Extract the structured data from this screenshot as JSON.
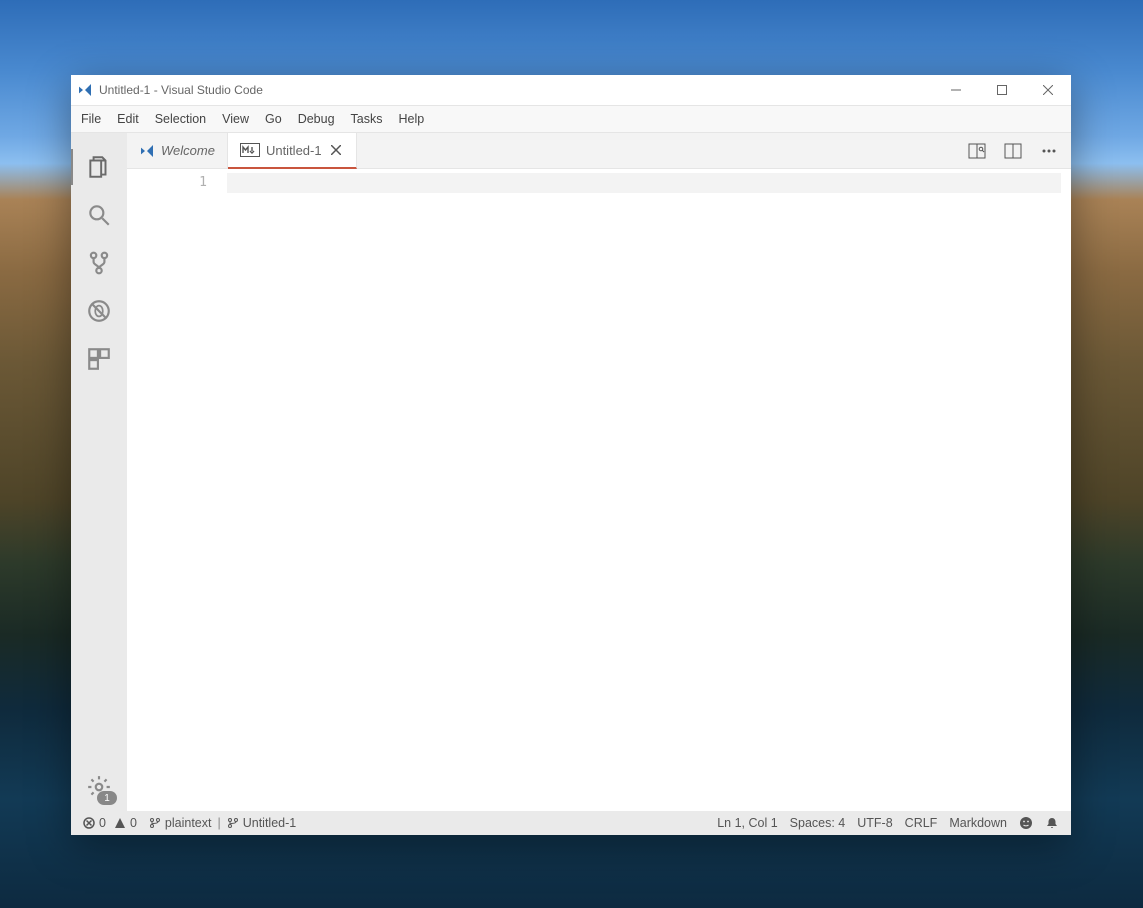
{
  "window": {
    "title": "Untitled-1 - Visual Studio Code"
  },
  "menubar": [
    "File",
    "Edit",
    "Selection",
    "View",
    "Go",
    "Debug",
    "Tasks",
    "Help"
  ],
  "activitybar": {
    "items": [
      {
        "name": "explorer-icon"
      },
      {
        "name": "search-icon"
      },
      {
        "name": "source-control-icon"
      },
      {
        "name": "debug-icon"
      },
      {
        "name": "extensions-icon"
      }
    ],
    "settings_badge": "1"
  },
  "tabs": [
    {
      "label": "Welcome",
      "icon": "vscode-icon",
      "italic": true,
      "active": false
    },
    {
      "label": "Untitled-1",
      "icon": "markdown-icon",
      "italic": false,
      "active": true
    }
  ],
  "editor": {
    "line_numbers": [
      "1"
    ]
  },
  "statusbar": {
    "errors": "0",
    "warnings": "0",
    "left_items": [
      {
        "icon": "git-branch-icon",
        "text": "plaintext"
      },
      {
        "separator": "|"
      },
      {
        "icon": "git-branch-icon",
        "text": "Untitled-1"
      }
    ],
    "cursor": "Ln 1, Col 1",
    "spaces": "Spaces: 4",
    "encoding": "UTF-8",
    "eol": "CRLF",
    "language": "Markdown"
  }
}
